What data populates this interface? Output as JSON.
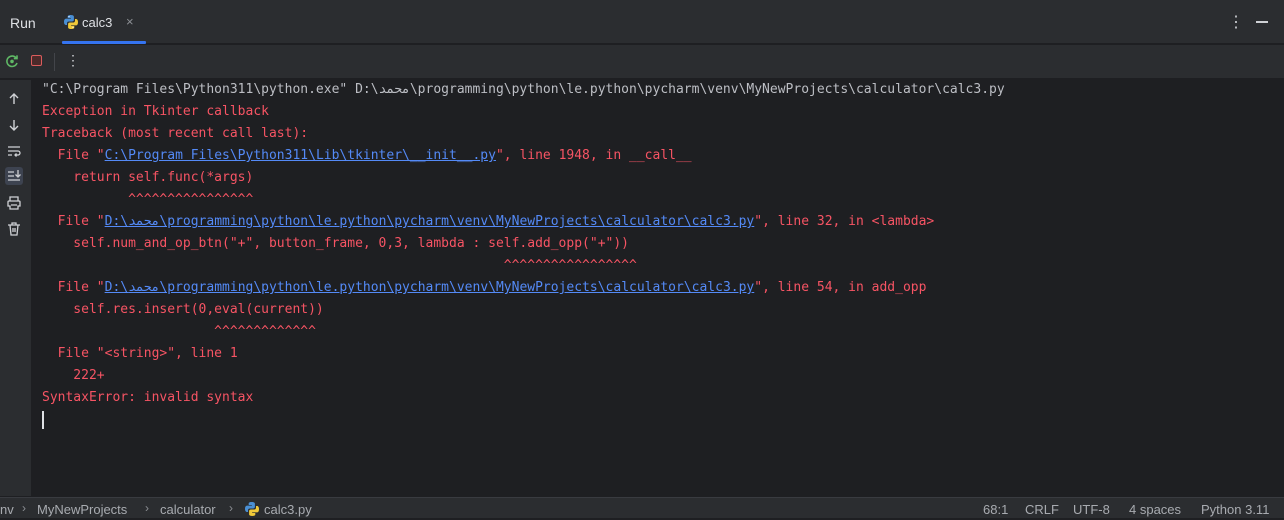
{
  "topbar": {
    "run_label": "Run",
    "tab_label": "calc3",
    "tab_close": "×",
    "tab_icon": "python-icon",
    "menu_icon": "more-vertical-icon",
    "minimize_icon": "minimize-icon"
  },
  "toolbar": {
    "rerun_icon": "rerun-icon",
    "stop_icon": "stop-icon",
    "more_icon": "more-vertical-icon"
  },
  "gutter": {
    "icons": [
      "arrow-up-icon",
      "arrow-down-icon",
      "soft-wrap-icon",
      "scroll-to-end-icon",
      "print-icon",
      "trash-icon"
    ]
  },
  "console": {
    "lines": [
      {
        "parts": [
          {
            "t": "\"C:\\Program Files\\Python311\\python.exe\" D:\\محمد\\programming\\python\\le.python\\pycharm\\venv\\MyNewProjects\\calculator\\calc3.py",
            "c": "cmd"
          }
        ]
      },
      {
        "parts": [
          {
            "t": "Exception in Tkinter callback",
            "c": "err"
          }
        ]
      },
      {
        "parts": [
          {
            "t": "Traceback (most recent call last):",
            "c": "err"
          }
        ]
      },
      {
        "parts": [
          {
            "t": "  File \"",
            "c": "err"
          },
          {
            "t": "C:\\Program Files\\Python311\\Lib\\tkinter\\__init__.py",
            "c": "link"
          },
          {
            "t": "\", line 1948, in __call__",
            "c": "err"
          }
        ]
      },
      {
        "parts": [
          {
            "t": "    return self.func(*args)",
            "c": "err"
          }
        ]
      },
      {
        "parts": [
          {
            "t": "           ^^^^^^^^^^^^^^^^",
            "c": "err"
          }
        ]
      },
      {
        "parts": [
          {
            "t": "  File \"",
            "c": "err"
          },
          {
            "t": "D:\\محمد\\programming\\python\\le.python\\pycharm\\venv\\MyNewProjects\\calculator\\calc3.py",
            "c": "link"
          },
          {
            "t": "\", line 32, in <lambda>",
            "c": "err"
          }
        ]
      },
      {
        "parts": [
          {
            "t": "    self.num_and_op_btn(\"+\", button_frame, 0,3, lambda : self.add_opp(\"+\"))",
            "c": "err"
          }
        ]
      },
      {
        "parts": [
          {
            "t": "                                                           ^^^^^^^^^^^^^^^^^",
            "c": "err"
          }
        ]
      },
      {
        "parts": [
          {
            "t": "  File \"",
            "c": "err"
          },
          {
            "t": "D:\\محمد\\programming\\python\\le.python\\pycharm\\venv\\MyNewProjects\\calculator\\calc3.py",
            "c": "link"
          },
          {
            "t": "\", line 54, in add_opp",
            "c": "err"
          }
        ]
      },
      {
        "parts": [
          {
            "t": "    self.res.insert(0,eval(current))",
            "c": "err"
          }
        ]
      },
      {
        "parts": [
          {
            "t": "                      ^^^^^^^^^^^^^",
            "c": "err"
          }
        ]
      },
      {
        "parts": [
          {
            "t": "  File \"<string>\", line 1",
            "c": "err"
          }
        ]
      },
      {
        "parts": [
          {
            "t": "    222+",
            "c": "err"
          }
        ]
      },
      {
        "parts": [
          {
            "t": "SyntaxError: invalid syntax",
            "c": "err"
          }
        ]
      }
    ]
  },
  "statusbar": {
    "breadcrumb_1": "nv",
    "breadcrumb_2": "MyNewProjects",
    "breadcrumb_3": "calculator",
    "breadcrumb_4": "calc3.py",
    "separator": "›",
    "position": "68:1",
    "line_separator": "CRLF",
    "encoding": "UTF-8",
    "indent": "4 spaces",
    "interpreter": "Python 3.11"
  }
}
